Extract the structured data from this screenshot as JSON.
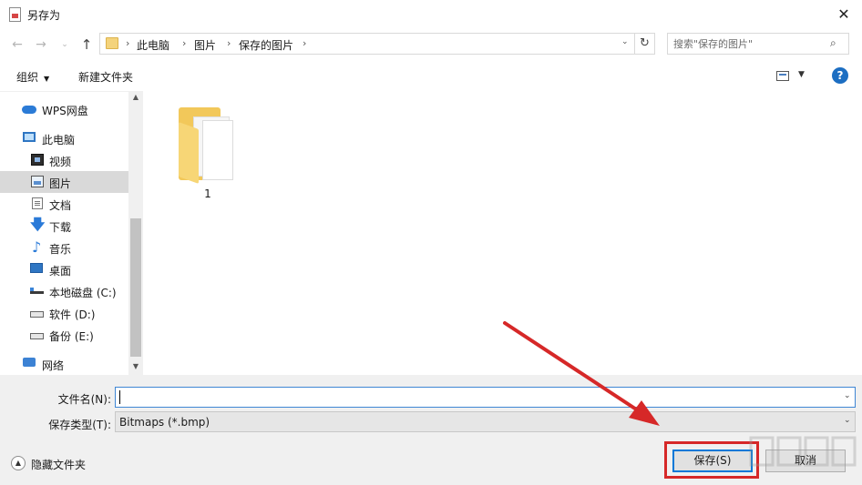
{
  "window": {
    "title": "另存为",
    "close_glyph": "✕"
  },
  "nav": {
    "back_glyph": "←",
    "forward_glyph": "→",
    "recent_glyph": "⌄",
    "up_glyph": "↑",
    "refresh_glyph": "↻"
  },
  "address": {
    "crumbs": [
      "此电脑",
      "图片",
      "保存的图片"
    ],
    "separator": "›",
    "dropdown_glyph": "⌄"
  },
  "search": {
    "placeholder": "搜索\"保存的图片\"",
    "icon": "search-icon",
    "icon_glyph": "⌕"
  },
  "toolbar": {
    "organize_label": "组织",
    "organize_caret": "▼",
    "new_folder_label": "新建文件夹",
    "view_dd_glyph": "▼",
    "help_glyph": "?"
  },
  "sidebar": {
    "items": [
      {
        "label": "WPS网盘",
        "icon": "cloud-icon"
      },
      {
        "label": "此电脑",
        "icon": "computer-icon"
      },
      {
        "label": "视频",
        "icon": "video-icon"
      },
      {
        "label": "图片",
        "icon": "pictures-icon",
        "selected": true
      },
      {
        "label": "文档",
        "icon": "documents-icon"
      },
      {
        "label": "下载",
        "icon": "download-icon",
        "glyph": "🡇"
      },
      {
        "label": "音乐",
        "icon": "music-icon",
        "glyph": "♪"
      },
      {
        "label": "桌面",
        "icon": "desktop-icon"
      },
      {
        "label": "本地磁盘 (C:)",
        "icon": "drive-c-icon"
      },
      {
        "label": "软件 (D:)",
        "icon": "drive-d-icon"
      },
      {
        "label": "备份 (E:)",
        "icon": "drive-e-icon"
      },
      {
        "label": "网络",
        "icon": "network-icon"
      }
    ],
    "scroll_up_glyph": "▲",
    "scroll_down_glyph": "▼"
  },
  "content": {
    "items": [
      {
        "name": "1",
        "type": "folder"
      }
    ]
  },
  "form": {
    "filename_label": "文件名(N):",
    "filename_value": "",
    "filetype_label": "保存类型(T):",
    "filetype_value": "Bitmaps (*.bmp)",
    "dropdown_glyph": "⌄"
  },
  "footer": {
    "hide_folders_label": "隐藏文件夹",
    "hide_glyph": "▲",
    "save_label": "保存(S)",
    "cancel_label": "取消"
  },
  "colors": {
    "accent": "#0078d7",
    "highlight": "#d62828",
    "folder": "#f2c85a"
  }
}
